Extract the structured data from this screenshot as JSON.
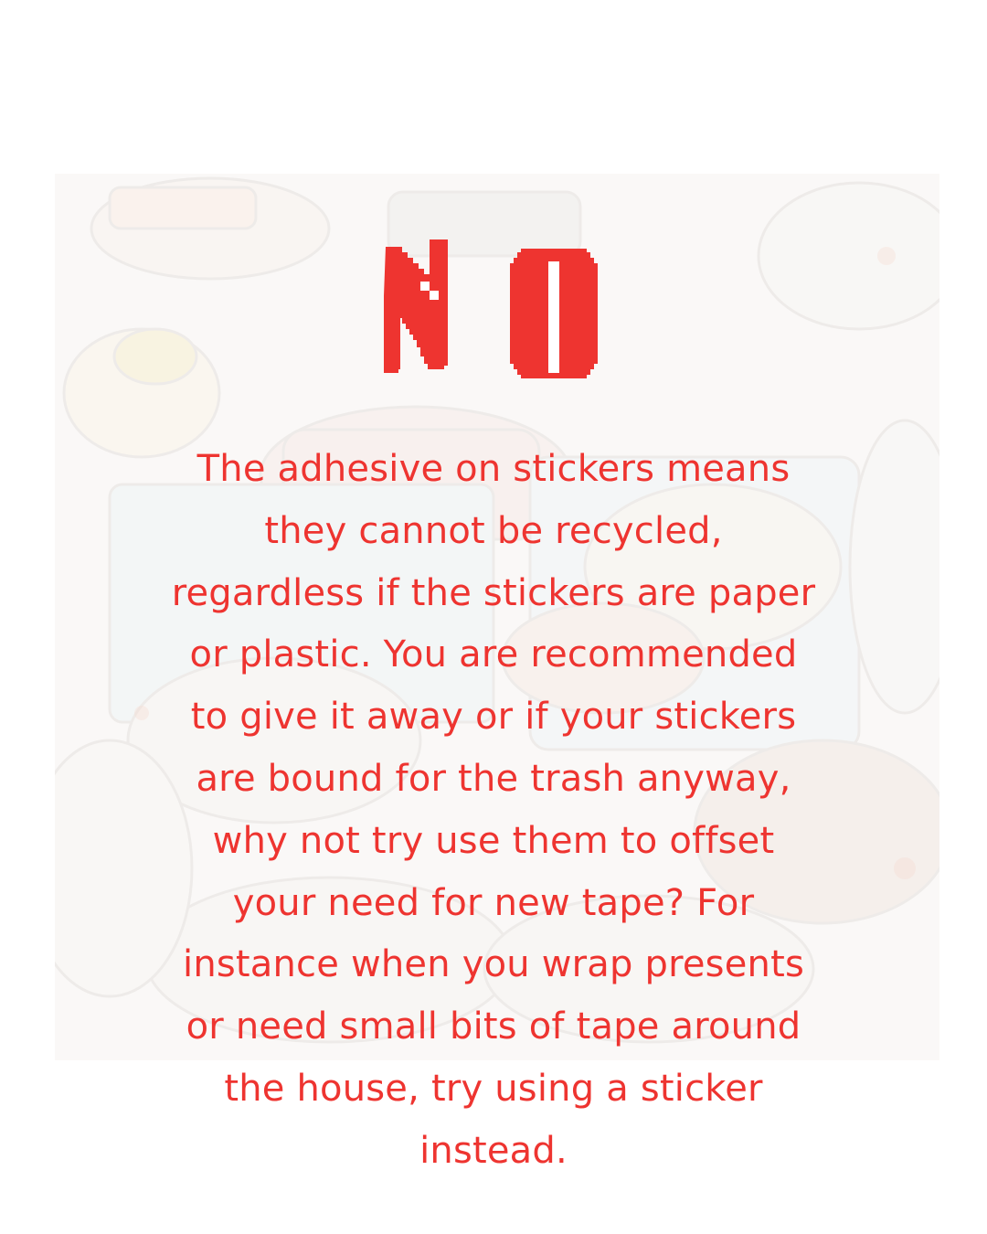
{
  "headline": "NO",
  "body_lines": [
    "The adhesive on stickers means",
    "they cannot be recycled,",
    "regardless if the stickers are paper",
    "or plastic. You are recommended",
    "to give it away or if your stickers",
    "are bound for the trash anyway,",
    "why not try use them to offset",
    "your need for new tape? For",
    "instance when you wrap presents",
    "or need small bits of tape around",
    "the house, try using a sticker",
    "instead."
  ],
  "colors": {
    "accent": "#ee3430",
    "background": "#ffffff"
  }
}
